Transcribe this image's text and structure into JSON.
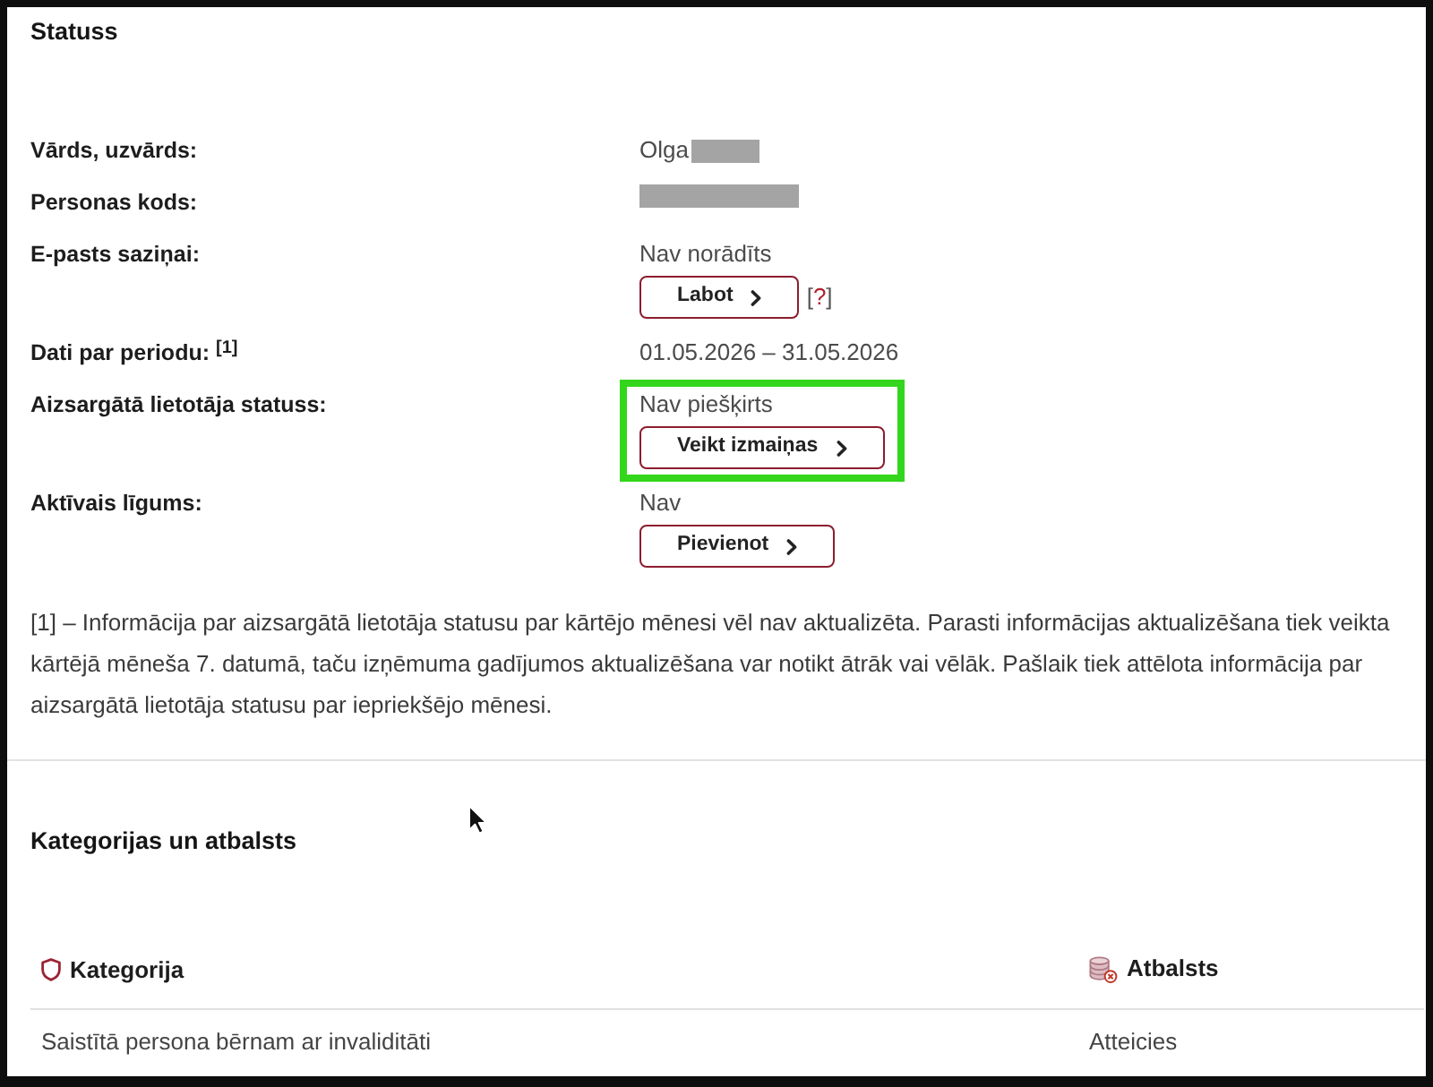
{
  "status_section": {
    "title": "Statuss",
    "fields": [
      {
        "label": "Vārds, uzvārds:",
        "value": "Olga",
        "redacted": true,
        "highlighted": false
      },
      {
        "label": "Personas kods:",
        "redacted": true,
        "highlighted": false
      },
      {
        "label": "E-pasts saziņai:",
        "value": "Nav norādīts",
        "button": "Labot",
        "help_link": [
          "[",
          "?",
          "]"
        ],
        "redacted": false,
        "highlighted": false
      },
      {
        "label": "Dati par periodu: $^{[1]}$",
        "value": "01.05.2026 – 31.05.2026",
        "redacted": false,
        "highlighted": false
      },
      {
        "label": "Aizsargātā lietotāja statuss:",
        "value": "Nav piešķirts",
        "button": "Veikt izmaiņas",
        "redacted": false,
        "highlighted": true
      },
      {
        "label": "Aktīvais līgums:",
        "value": "Nav",
        "button": "Pievienot",
        "redacted": false,
        "highlighted": false
      }
    ],
    "footnote": "[1] – Informācija par aizsargātā lietotāja statusu par kārtējo mēnesi vēl nav aktualizēta. Parasti informācijas aktualizēšana tiek veikta kārtējā mēneša 7. datumā, taču izņēmuma gadījumos aktualizēšana var notikt ātrāk vai vēlāk. Pašlaik tiek attēlota informācija par aizsargātā lietotāja statusu par iepriekšējo mēnesi."
  },
  "categories_section": {
    "title": "Kategorijas un atbalsts",
    "table": {
      "columns": [
        "Kategorija",
        "Atbalsts"
      ],
      "rows": [
        [
          "Saistītā persona bērnam ar invaliditāti",
          "Atteicies"
        ]
      ]
    }
  }
}
